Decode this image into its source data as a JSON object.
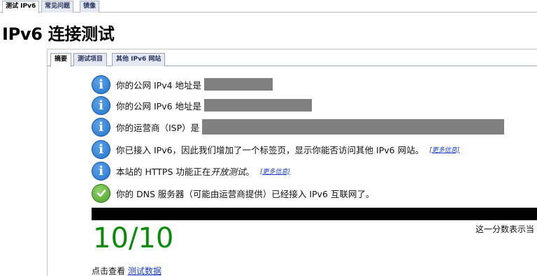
{
  "top_tabs": [
    "测试 IPv6",
    "常见问题",
    "镜像"
  ],
  "page_title": "IPv6 连接测试",
  "inner_tabs": [
    "摘要",
    "测试项目",
    "其他 IPv6 网站"
  ],
  "rows": [
    {
      "icon": "info-icon",
      "text": "你的公网 IPv4 地址是"
    },
    {
      "icon": "info-icon",
      "text": "你的公网 IPv6 地址是"
    },
    {
      "icon": "info-icon",
      "text": "你的运营商（ISP）是"
    },
    {
      "icon": "info-icon",
      "text": "你已接入 IPv6，因此我们增加了一个标签页，显示你能否访问其他 IPv6 网站。",
      "more": "[更多信息]"
    },
    {
      "icon": "info-icon",
      "text_prefix": "本站的 HTTPS 功能正在",
      "text_em": "开放测试",
      "text_suffix": "。",
      "more": "[更多信息]"
    },
    {
      "icon": "checkmark-icon",
      "text": "你的 DNS 服务器（可能由运营商提供）已经接入 IPv6 互联网了。"
    }
  ],
  "score": "10/10",
  "score_note": "这一分数表示当",
  "footer": {
    "prefix": "点击查看 ",
    "link": "测试数据"
  },
  "colors": {
    "score": "#0a8a0a",
    "link": "#1a3ccc",
    "info": "#1f6fc8",
    "ok": "#4a9a2a"
  }
}
